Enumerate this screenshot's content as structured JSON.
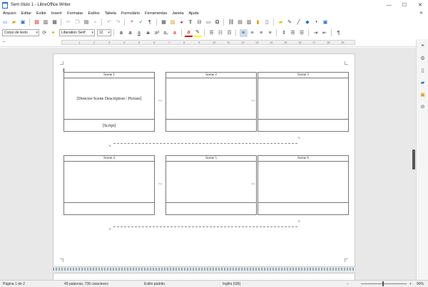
{
  "window": {
    "title": "Sem título 1 - LibreOffice Writer",
    "controls": [
      "—",
      "☐",
      "✕"
    ]
  },
  "menu": {
    "items": [
      "Arquivo",
      "Editar",
      "Exibir",
      "Inserir",
      "Formatar",
      "Estilos",
      "Tabela",
      "Formulário",
      "Ferramentas",
      "Janela",
      "Ajuda"
    ],
    "close_doc": "✕"
  },
  "format_bar": {
    "paragraph_style": "Corpo de texto",
    "font_name": "Liberation Serif",
    "font_size": "12"
  },
  "ruler": {
    "ticks": [
      "1",
      "2",
      "3",
      "4",
      "5",
      "6",
      "7",
      "8",
      "9",
      "10",
      "11",
      "12",
      "13",
      "14",
      "15",
      "16",
      "17",
      "18",
      "19"
    ]
  },
  "document": {
    "scenes": [
      {
        "title": "Scene 1",
        "body": "[Director Scene Description / Picture]",
        "foot": "[Script]"
      },
      {
        "title": "Scene 2",
        "body": "",
        "foot": ""
      },
      {
        "title": "Scene 3",
        "body": "",
        "foot": ""
      },
      {
        "title": "Scene 4",
        "body": "",
        "foot": ""
      },
      {
        "title": "Scene 5",
        "body": "",
        "foot": ""
      },
      {
        "title": "Scene 6",
        "body": "",
        "foot": ""
      }
    ],
    "arrow_label": ">>",
    "v_label": "v"
  },
  "status": {
    "page": "Página 1 de 2",
    "words": "49 palavras, 736 caracteres",
    "page_style": "Estilo padrão",
    "language": "Inglês (GB)",
    "zoom": "90%"
  }
}
